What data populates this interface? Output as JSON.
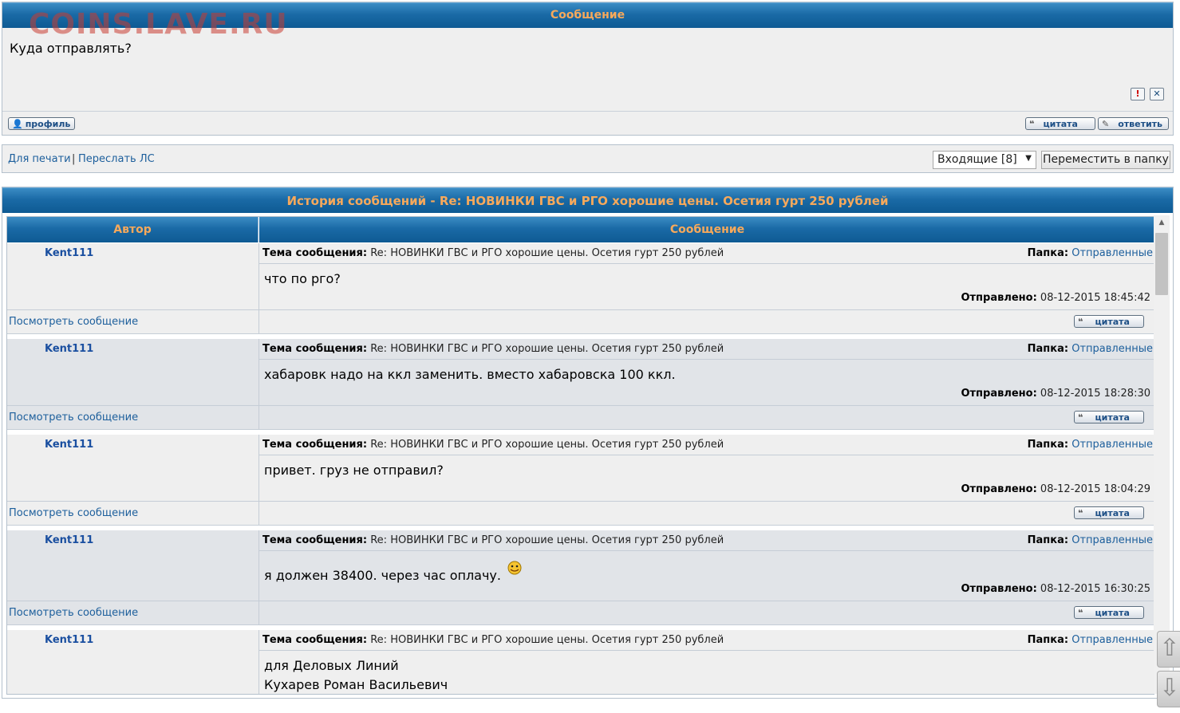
{
  "watermark": "COINS.LAVE.RU",
  "message": {
    "header": "Сообщение",
    "text": "Куда отправлять?",
    "report_icon": "exclamation-icon",
    "delete_icon": "x-icon",
    "profile_label": "профиль",
    "quote_label": "цитата",
    "reply_label": "ответить"
  },
  "actions": {
    "print_label": "Для печати",
    "separator": "|",
    "forward_label": "Переслать ЛС",
    "folder_selected": "Входящие [8]",
    "move_label": "Переместить в папку"
  },
  "history": {
    "title": "История сообщений - Re: НОВИНКИ ГВС и РГО хорошие цены. Осетия гурт 250 рублей",
    "col_author": "Автор",
    "col_message": "Сообщение",
    "subject_label": "Тема сообщения:",
    "folder_label": "Папка:",
    "sent_label": "Отправлено:",
    "view_label": "Посмотреть сообщение",
    "quote_label": "цитата",
    "entries": [
      {
        "author": "Kent111",
        "subject": "Re: НОВИНКИ ГВС и РГО хорошие цены. Осетия гурт 250 рублей",
        "folder": "Отправленные",
        "body": [
          "что по рго?"
        ],
        "sent": "08-12-2015 18:45:42"
      },
      {
        "author": "Kent111",
        "subject": "Re: НОВИНКИ ГВС и РГО хорошие цены. Осетия гурт 250 рублей",
        "folder": "Отправленные",
        "body": [
          "хабаровк надо на ккл заменить. вместо хабаровска 100 ккл."
        ],
        "sent": "08-12-2015 18:28:30"
      },
      {
        "author": "Kent111",
        "subject": "Re: НОВИНКИ ГВС и РГО хорошие цены. Осетия гурт 250 рублей",
        "folder": "Отправленные",
        "body": [
          "привет. груз не отправил?"
        ],
        "sent": "08-12-2015 18:04:29"
      },
      {
        "author": "Kent111",
        "subject": "Re: НОВИНКИ ГВС и РГО хорошие цены. Осетия гурт 250 рублей",
        "folder": "Отправленные",
        "body": [
          "я должен 38400. через час оплачу."
        ],
        "sent": "08-12-2015 16:30:25"
      },
      {
        "author": "Kent111",
        "subject": "Re: НОВИНКИ ГВС и РГО хорошие цены. Осетия гурт 250 рублей",
        "folder": "Отправленные",
        "body": [
          "для Деловых Линий",
          "Кухарев Роман Васильевич"
        ],
        "sent": ""
      }
    ]
  },
  "nav": {
    "up_icon": "arrow-up-icon",
    "down_icon": "arrow-down-icon"
  }
}
